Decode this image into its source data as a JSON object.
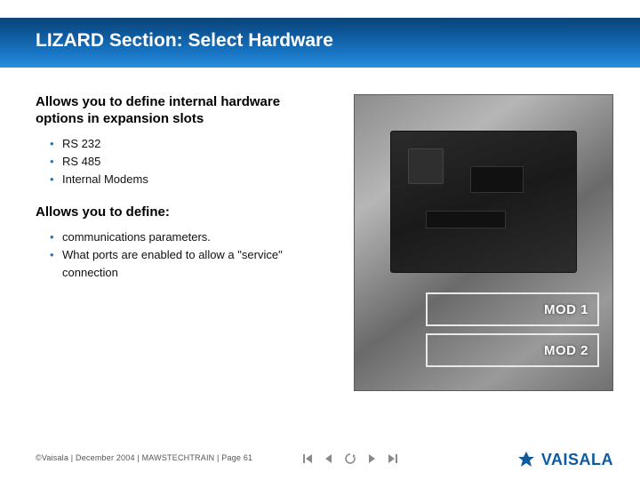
{
  "title": "LIZARD Section: Select Hardware",
  "section1": {
    "heading": "Allows you to define internal hardware options in expansion slots",
    "items": [
      "RS 232",
      "RS 485",
      "Internal Modems"
    ]
  },
  "section2": {
    "heading": "Allows you to define:",
    "items": [
      "communications parameters.",
      "What ports are enabled to allow a \"service\" connection"
    ]
  },
  "image": {
    "mod1_label": "MOD 1",
    "mod2_label": "MOD 2"
  },
  "footer": "©Vaisala | December 2004 | MAWSTECHTRAIN | Page 61",
  "logo_text": "VAISALA"
}
